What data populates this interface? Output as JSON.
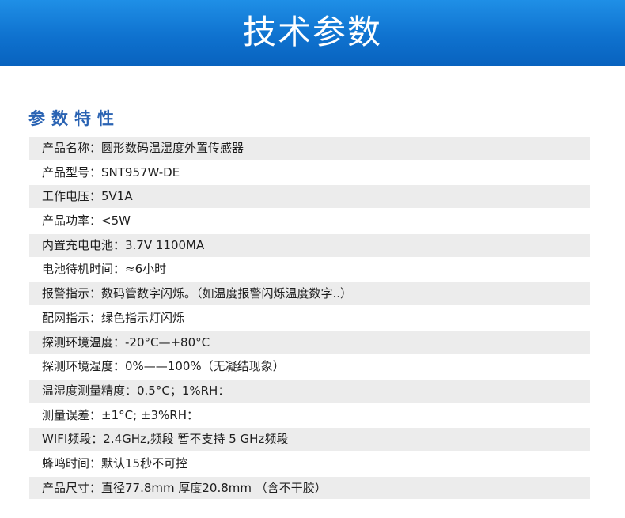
{
  "header": {
    "title": "技术参数"
  },
  "section": {
    "title": "参数特性"
  },
  "specs": [
    {
      "text": "产品名称：圆形数码温湿度外置传感器"
    },
    {
      "text": "产品型号：SNT957W-DE"
    },
    {
      "text": "工作电压：5V1A"
    },
    {
      "text": "产品功率：<5W"
    },
    {
      "text": "内置充电电池：3.7V 1100MA"
    },
    {
      "text": "电池待机时间：≈6小时"
    },
    {
      "text": "报警指示：数码管数字闪烁。（如温度报警闪烁温度数字..）"
    },
    {
      "text": "配网指示：绿色指示灯闪烁"
    },
    {
      "text": "探测环境温度：-20°C—+80°C"
    },
    {
      "text": "探测环境湿度：0%——100%（无凝结现象）"
    },
    {
      "text": "温湿度测量精度：0.5°C；1%RH："
    },
    {
      "text": "测量误差：±1°C; ±3%RH："
    },
    {
      "text": "WIFI频段：2.4GHz,频段 暂不支持 5 GHz频段"
    },
    {
      "text": "蜂鸣时间：默认15秒不可控"
    },
    {
      "text": "产品尺寸：直径77.8mm 厚度20.8mm （含不干胶）"
    }
  ],
  "colors": {
    "banner": "#0f72cf",
    "section_title": "#2a63b3",
    "row_shade": "#ececec",
    "text": "#1e1e1e"
  }
}
